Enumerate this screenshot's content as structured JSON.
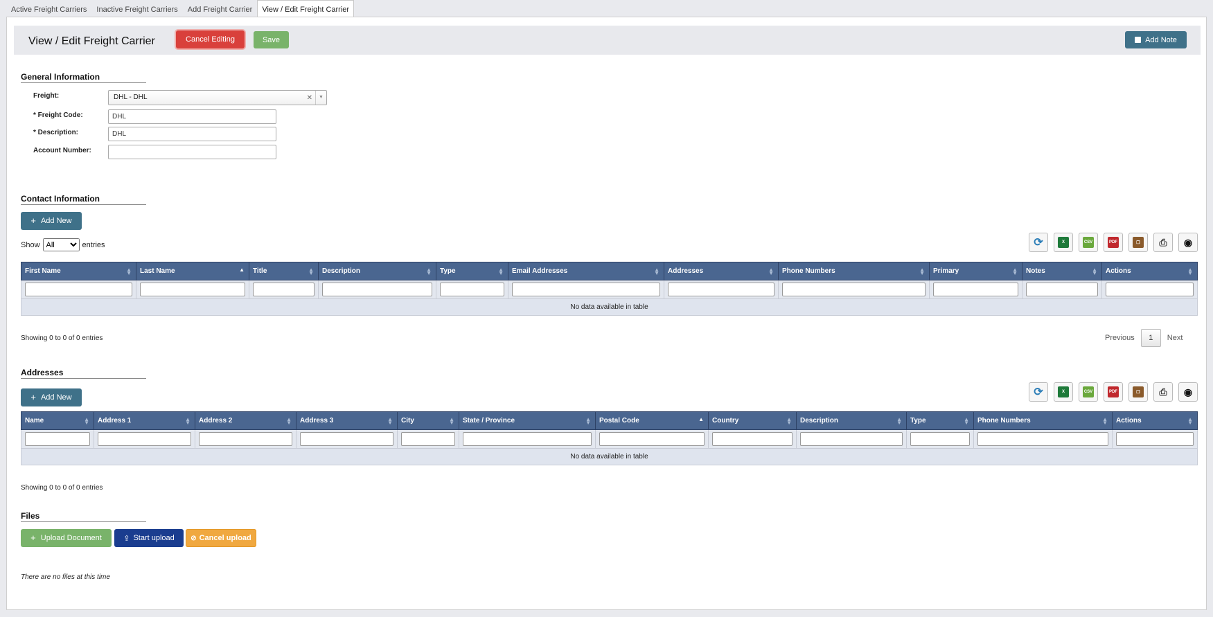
{
  "tabs": [
    "Active Freight Carriers",
    "Inactive Freight Carriers",
    "Add Freight Carrier",
    "View / Edit Freight Carrier"
  ],
  "header": {
    "title": "View / Edit Freight Carrier",
    "cancel_label": "Cancel Editing",
    "save_label": "Save",
    "add_note_label": "Add Note"
  },
  "general": {
    "title": "General Information",
    "freight_label": "Freight:",
    "freight_value": "DHL - DHL",
    "code_label": "* Freight Code:",
    "code_value": "DHL",
    "desc_label": "* Description:",
    "desc_value": "DHL",
    "account_label": "Account Number:",
    "account_value": ""
  },
  "contact": {
    "title": "Contact Information",
    "add_label": "Add New",
    "show_label": "Show",
    "show_value": "All",
    "entries_label": "entries",
    "columns": [
      "First Name",
      "Last Name",
      "Title",
      "Description",
      "Type",
      "Email Addresses",
      "Addresses",
      "Phone Numbers",
      "Primary",
      "Notes",
      "Actions"
    ],
    "empty": "No data available in table",
    "info": "Showing 0 to 0 of 0 entries",
    "prev": "Previous",
    "page": "1",
    "next": "Next"
  },
  "addresses": {
    "title": "Addresses",
    "add_label": "Add New",
    "columns": [
      "Name",
      "Address 1",
      "Address 2",
      "Address 3",
      "City",
      "State / Province",
      "Postal Code",
      "Country",
      "Description",
      "Type",
      "Phone Numbers",
      "Actions"
    ],
    "empty": "No data available in table",
    "info": "Showing 0 to 0 of 0 entries"
  },
  "files": {
    "title": "Files",
    "upload_label": "Upload Document",
    "start_label": "Start upload",
    "cancel_label": "Cancel upload",
    "empty": "There are no files at this time"
  },
  "toolbar_icons": [
    "refresh-icon",
    "excel-icon",
    "csv-icon",
    "pdf-icon",
    "copy-icon",
    "print-icon",
    "eye-icon"
  ],
  "colors": {
    "accent": "#3f7189",
    "danger": "#d9403b",
    "success": "#79b36a",
    "table_header": "#4a6690",
    "start_upload": "#1a3d8f",
    "cancel_upload": "#f0a840"
  }
}
